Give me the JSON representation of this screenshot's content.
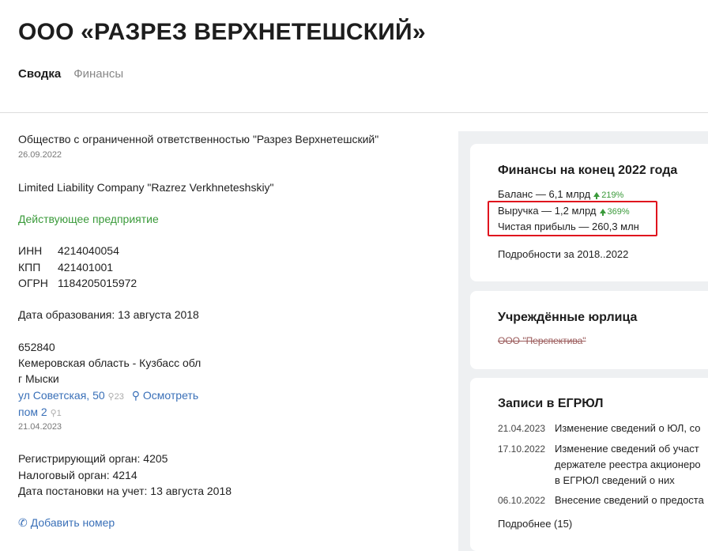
{
  "header": {
    "title": "ООО «РАЗРЕЗ ВЕРХНЕТЕШСКИЙ»",
    "tabs": [
      {
        "label": "Сводка",
        "active": true
      },
      {
        "label": "Финансы",
        "active": false
      }
    ]
  },
  "left": {
    "full_name": "Общество с ограниченной ответственностью \"Разрез Верхнетешский\"",
    "full_name_date": "26.09.2022",
    "english_name": "Limited Liability Company \"Razrez Verkhneteshskiy\"",
    "status": "Действующее предприятие",
    "requisites": [
      {
        "label": "ИНН",
        "value": "4214040054"
      },
      {
        "label": "КПП",
        "value": "421401001"
      },
      {
        "label": "ОГРН",
        "value": "1184205015972"
      }
    ],
    "founded": "Дата образования: 13 августа 2018",
    "address": {
      "zip": "652840",
      "region": "Кемеровская область - Кузбасс обл",
      "city": "г Мыски",
      "street": "ул Советская, 50",
      "street_count": "23",
      "view_label": "Осмотреть",
      "room": "пом 2",
      "room_count": "1",
      "date": "21.04.2023"
    },
    "registrar": "Регистрирующий орган: 4205",
    "tax_office": "Налоговый орган: 4214",
    "registration_date": "Дата постановки на учет: 13 августа 2018",
    "add_phone": "Добавить номер"
  },
  "finance_card": {
    "title": "Финансы на конец 2022 года",
    "balance": "Баланс — 6,1 млрд",
    "balance_delta": "219%",
    "revenue": "Выручка — 1,2 млрд",
    "revenue_delta": "369%",
    "profit": "Чистая прибыль — 260,3 млн",
    "details_link": "Подробности за 2018..2022",
    "accent": "#e0141e"
  },
  "founded_entities": {
    "title": "Учреждённые юрлица",
    "items": [
      "ООО \"Перспектива\""
    ]
  },
  "egrul": {
    "title": "Записи в ЕГРЮЛ",
    "rows": [
      {
        "date": "21.04.2023",
        "lines": [
          "Изменение сведений о ЮЛ, со"
        ]
      },
      {
        "date": "17.10.2022",
        "lines": [
          "Изменение сведений об участ",
          "держателе реестра акционеро",
          "в ЕГРЮЛ сведений о них"
        ]
      },
      {
        "date": "06.10.2022",
        "lines": [
          "Внесение сведений о предоста"
        ]
      }
    ],
    "more_link": "Подробнее (15)"
  }
}
